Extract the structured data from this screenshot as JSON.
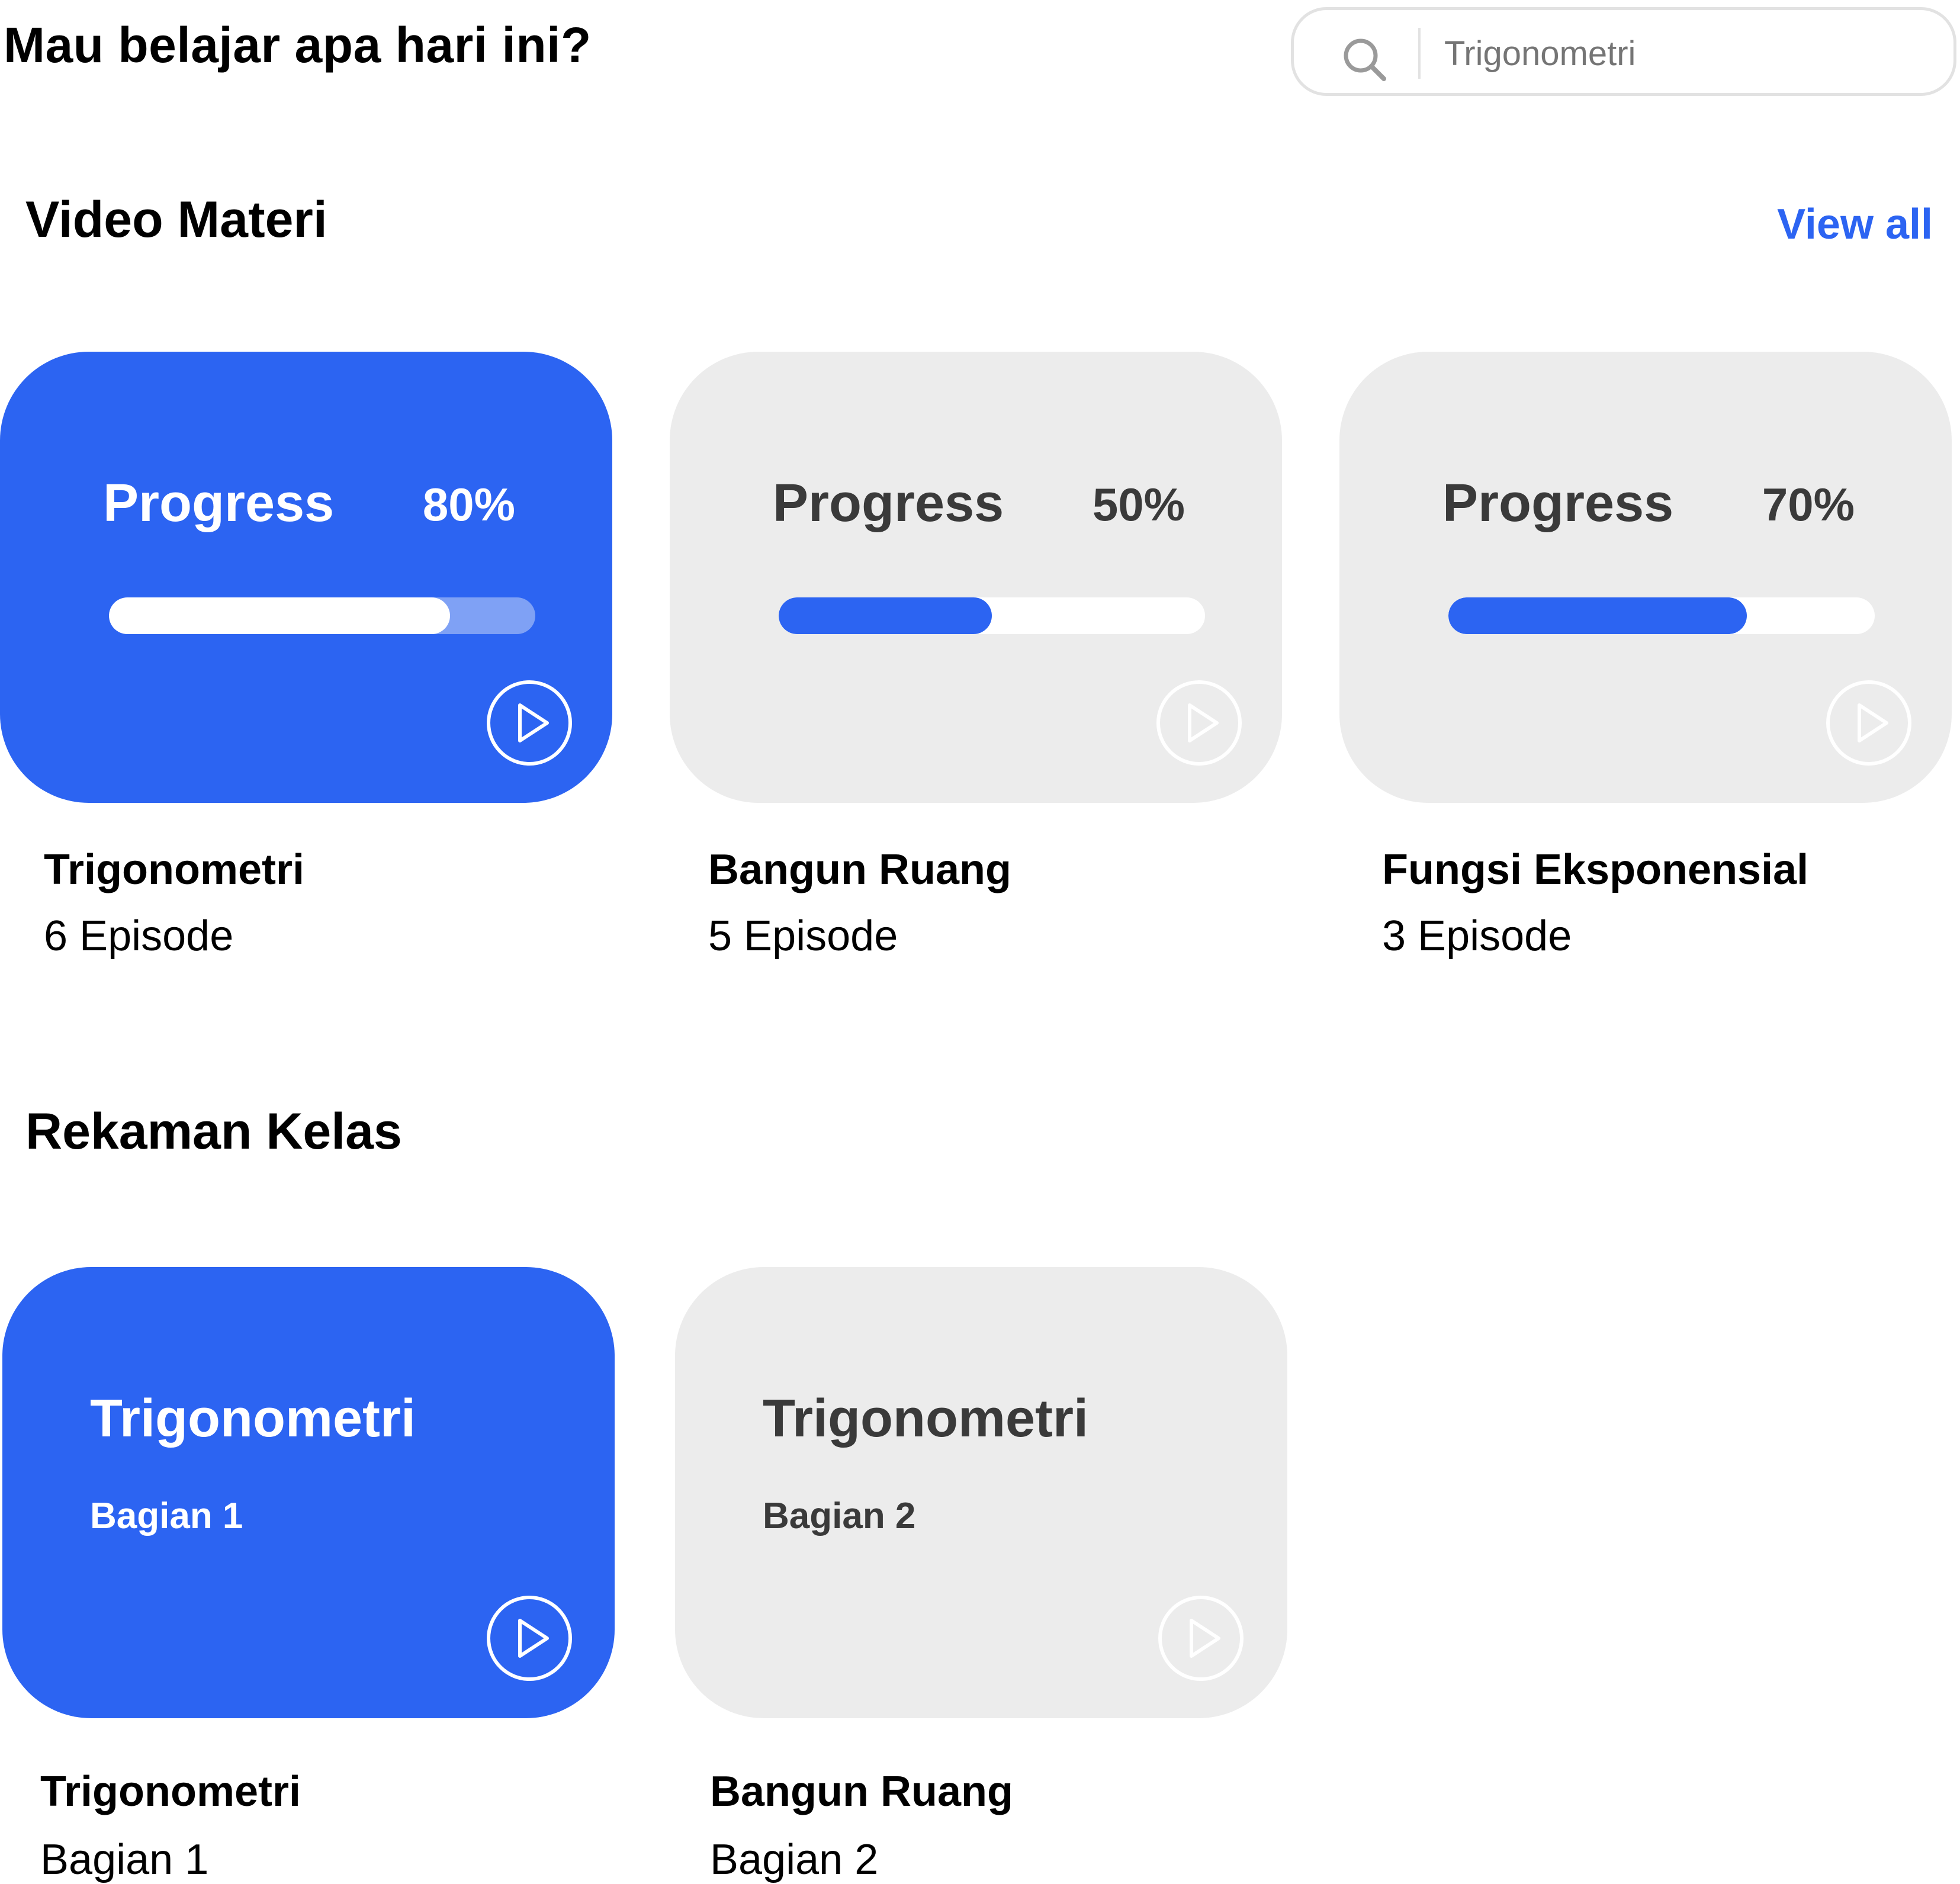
{
  "header": {
    "title": "Mau belajar apa hari ini?"
  },
  "search": {
    "value": "",
    "placeholder": "Trigonometri",
    "icon": "search-icon"
  },
  "video_section": {
    "title": "Video Materi",
    "view_all": "View all",
    "cards": [
      {
        "progress_label": "Progress",
        "progress_value": "80%",
        "progress_fraction": 0.8,
        "style": "blue",
        "title": "Trigonometri",
        "subtitle": "6 Episode",
        "icon": "play-icon"
      },
      {
        "progress_label": "Progress",
        "progress_value": "50%",
        "progress_fraction": 0.5,
        "style": "gray",
        "title": "Bangun Ruang",
        "subtitle": "5 Episode",
        "icon": "play-icon"
      },
      {
        "progress_label": "Progress",
        "progress_value": "70%",
        "progress_fraction": 0.7,
        "style": "gray",
        "title": "Fungsi Eksponensial",
        "subtitle": "3 Episode",
        "icon": "play-icon"
      }
    ]
  },
  "recording_section": {
    "title": "Rekaman Kelas",
    "cards": [
      {
        "card_title": "Trigonometri",
        "card_subtitle": "Bagian 1",
        "style": "blue",
        "title": "Trigonometri",
        "subtitle": "Bagian 1",
        "icon": "play-icon"
      },
      {
        "card_title": "Trigonometri",
        "card_subtitle": "Bagian 2",
        "style": "gray",
        "title": "Bangun Ruang",
        "subtitle": "Bagian 2",
        "icon": "play-icon"
      }
    ]
  },
  "colors": {
    "accent": "#2c64f2",
    "card_gray": "#ececec",
    "track_light": "#7fa1f5",
    "border": "#e2e2e2"
  }
}
